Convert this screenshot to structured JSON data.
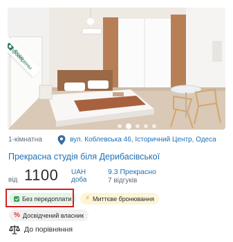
{
  "listing": {
    "photo": {
      "ribbon_text": "Фото\nпроверены",
      "ribbon_line1": "Фото",
      "ribbon_line2": "проверены",
      "ribbon_icon": "camera-icon",
      "slide_count": 5,
      "active_slide": 2
    },
    "room_type": "1-кімнатна",
    "address_icon": "map-pin-icon",
    "address": "вул. Коблевська 46, Історичний Центр, Одеса",
    "title": "Прекрасна студія біля Дерибасівської",
    "price": {
      "from": "від",
      "amount": "1100",
      "currency": "UAH",
      "per": "доба"
    },
    "rating": {
      "score_text": "9.3 Прекрасно",
      "reviews": "7 відгуків"
    },
    "badges": [
      {
        "label": "Без передоплати",
        "icon": "check-icon",
        "color": "#e6f4e9"
      },
      {
        "label": "Миттєве бронювання",
        "icon": "lightning-icon",
        "color": "#fdf5d8"
      },
      {
        "label": "Досвідчений власник",
        "icon": "percent-icon",
        "color": "#f1f1f1"
      }
    ],
    "compare": {
      "label": "До порівняння",
      "icon": "scales-icon"
    },
    "colors": {
      "link": "#1f6fb5",
      "highlight": "#d21f1f",
      "verified": "#2e7d5b"
    }
  }
}
